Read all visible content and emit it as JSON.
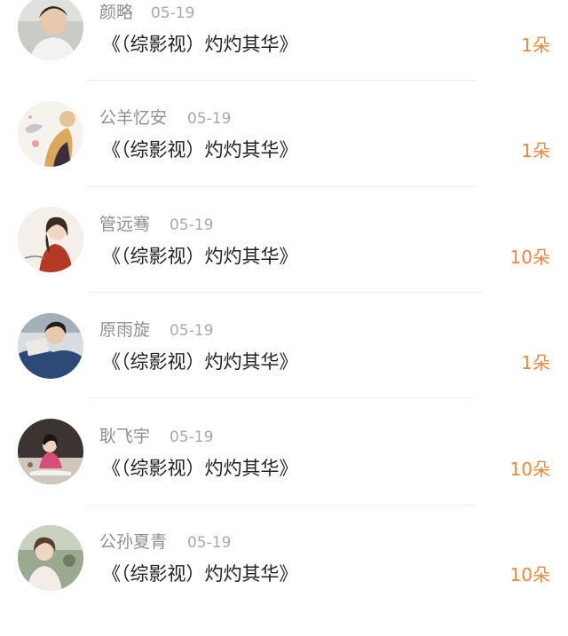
{
  "colors": {
    "name_text": "#8f8f8f",
    "date_text": "#a9a9a9",
    "message_text": "#222222",
    "count_accent": "#f0873a",
    "divider": "#efefef"
  },
  "list": {
    "items": [
      {
        "name": "颜略",
        "date": "05-19",
        "message": "《（综影视）灼灼其华》",
        "count": "1朵",
        "avatar": "avatar-man-portrait"
      },
      {
        "name": "公羊忆安",
        "date": "05-19",
        "message": "《（综影视）灼灼其华》",
        "count": "1朵",
        "avatar": "avatar-illustration-bird"
      },
      {
        "name": "管远骞",
        "date": "05-19",
        "message": "《（综影视）灼灼其华》",
        "count": "10朵",
        "avatar": "avatar-illustration-girl"
      },
      {
        "name": "原雨旋",
        "date": "05-19",
        "message": "《（综影视）灼灼其华》",
        "count": "1朵",
        "avatar": "avatar-man-reading"
      },
      {
        "name": "耿飞宇",
        "date": "05-19",
        "message": "《（综影视）灼灼其华》",
        "count": "10朵",
        "avatar": "avatar-woman-sitting"
      },
      {
        "name": "公孙夏青",
        "date": "05-19",
        "message": "《（综影视）灼灼其华》",
        "count": "10朵",
        "avatar": "avatar-woman-outdoor"
      }
    ]
  }
}
